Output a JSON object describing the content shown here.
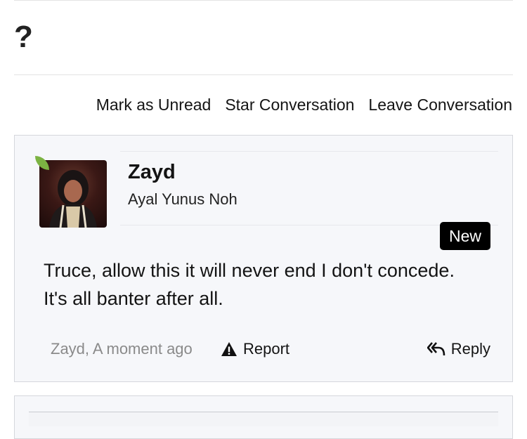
{
  "thread": {
    "title": "?"
  },
  "actions": {
    "mark_unread": "Mark as Unread",
    "star": "Star Conversation",
    "leave": "Leave Conversation"
  },
  "message": {
    "username": "Zayd",
    "user_title": "Ayal Yunus Noh",
    "badge": "New",
    "body": "Truce, allow this it will never end I don't concede. It's all banter after all.",
    "meta": "Zayd, A moment ago",
    "report_label": "Report",
    "reply_label": "Reply",
    "online_color": "#7cb342"
  }
}
